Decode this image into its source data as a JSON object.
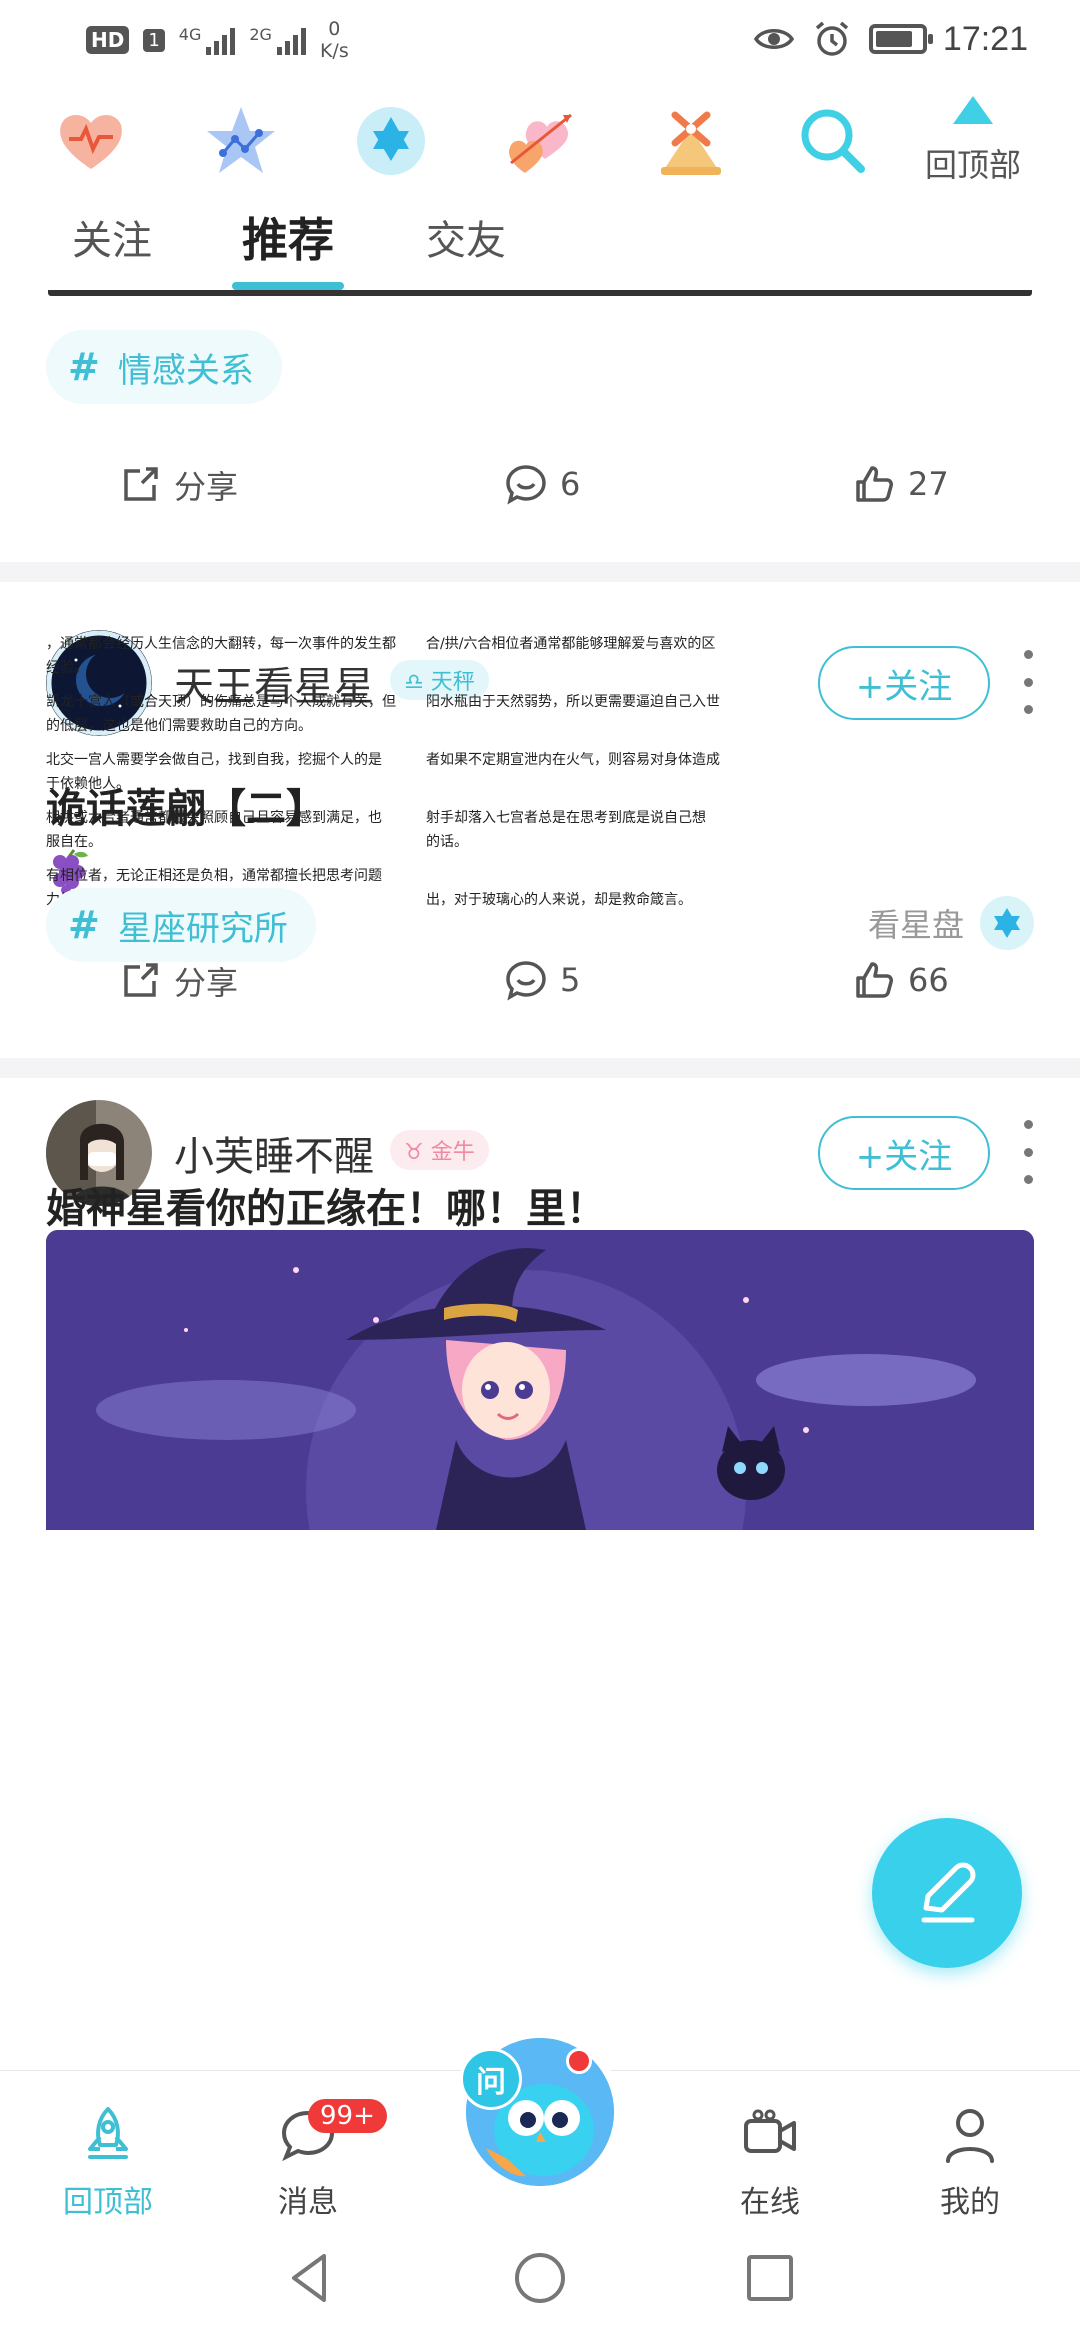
{
  "status_bar": {
    "hd": "HD",
    "sim": "1",
    "network_1": "4G",
    "network_2": "2G",
    "speed_value": "0",
    "speed_unit": "K/s",
    "time": "17:21",
    "battery_percent": 75
  },
  "top_icons": {
    "icons": [
      "heart-pulse-icon",
      "star-chart-icon",
      "hexagram-icon",
      "hearts-cupid-icon",
      "windmill-icon",
      "search-icon"
    ],
    "to_top_label": "回顶部"
  },
  "tabs": {
    "items": [
      "关注",
      "推荐",
      "交友"
    ],
    "active": "推荐"
  },
  "post_prev": {
    "topic_tag": "情感关系",
    "share_label": "分享",
    "comment_count": "6",
    "like_count": "27"
  },
  "post_1": {
    "username": "天王看星星",
    "sign": "♎ 天秤",
    "follow_label": "+关注",
    "title": "诡话莲翩【二】",
    "image_text_left": [
      "，通常都会经历人生信念的大翻转，每一次事件的发生都",
      "经验。",
      "凯龙十宫人（或合天顶）的伤痛总是与个人成就有关，但",
      "的低层，这也是他们需要救助自己的方向。",
      "北交一宫人需要学会做自己，找到自我，挖掘个人的是",
      "于依赖他人。",
      "相拱或六合者通常都很会照顾自己且容易感到满足，也",
      "服自在。",
      "有相位者，无论正相还是负相，通常都擅长把思考问题",
      "力结合且运用自如。"
    ],
    "image_text_right": [
      "合/拱/六合相位者通常都能够理解爱与喜欢的区",
      "阳水瓶由于天然弱势，所以更需要逼迫自己入世",
      "者如果不定期宣泄内在火气，则容易对身体造成",
      "射手却落入七宫者总是在思考到底是说自己想",
      "的话。",
      "出，对于玻璃心的人来说，却是救命箴言。"
    ],
    "topic_tag": "星座研究所",
    "chart_link_label": "看星盘",
    "share_label": "分享",
    "comment_count": "5",
    "like_count": "66"
  },
  "post_2": {
    "username": "小芙睡不醒",
    "sign": "♉ 金牛",
    "follow_label": "+关注",
    "title": "婚神星看你的正缘在！哪！里！"
  },
  "ask_label": "问",
  "bottom_nav": {
    "items": [
      {
        "label": "回顶部",
        "icon": "rocket-icon"
      },
      {
        "label": "消息",
        "icon": "chat-bubble-icon"
      },
      {
        "label": "在线",
        "icon": "video-camera-icon"
      },
      {
        "label": "我的",
        "icon": "person-icon"
      }
    ],
    "message_badge": "99+",
    "active": "回顶部"
  },
  "colors": {
    "accent": "#3fbfd4",
    "badge_red": "#f03a3a",
    "banner_purple": "#4a3a8f"
  }
}
